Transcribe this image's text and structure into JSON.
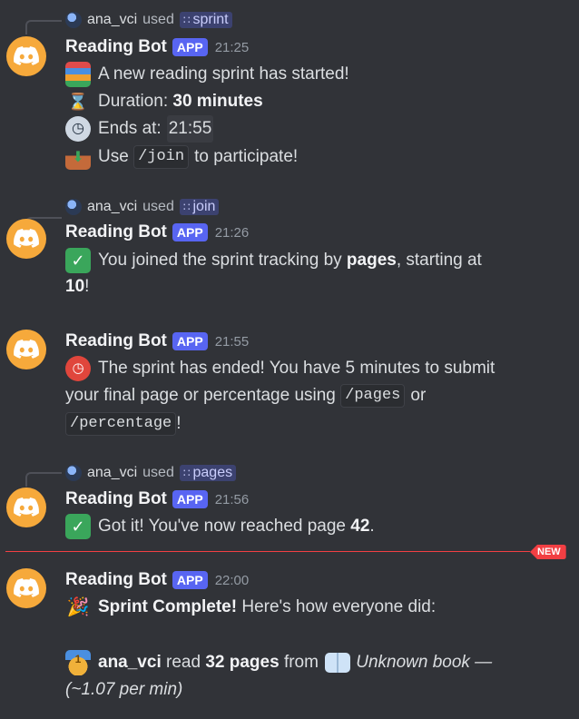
{
  "messages": [
    {
      "reply": {
        "user": "ana_vci",
        "used": "used",
        "command": "sprint"
      },
      "author": "Reading Bot",
      "badge": "APP",
      "time": "21:25",
      "lines": {
        "l1": "A new reading sprint has started!",
        "duration_label": "Duration:",
        "duration_value": "30 minutes",
        "ends_label": "Ends at:",
        "ends_value": "21:55",
        "use_label": "Use",
        "use_code": "/join",
        "use_suffix": "to participate!"
      }
    },
    {
      "reply": {
        "user": "ana_vci",
        "used": "used",
        "command": "join"
      },
      "author": "Reading Bot",
      "badge": "APP",
      "time": "21:26",
      "lines": {
        "prefix": "You joined the sprint tracking by",
        "bold": "pages",
        "suffix": ", starting at",
        "value": "10",
        "end": "!"
      }
    },
    {
      "author": "Reading Bot",
      "badge": "APP",
      "time": "21:55",
      "lines": {
        "l1": "The sprint has ended! You have 5 minutes to submit",
        "l2": "your final page or percentage using",
        "code1": "/pages",
        "or": "or",
        "code2": "/percentage",
        "end": "!"
      }
    },
    {
      "reply": {
        "user": "ana_vci",
        "used": "used",
        "command": "pages"
      },
      "author": "Reading Bot",
      "badge": "APP",
      "time": "21:56",
      "lines": {
        "prefix": "Got it! You've now reached page",
        "value": "42",
        "end": "."
      }
    },
    {
      "author": "Reading Bot",
      "badge": "APP",
      "time": "22:00",
      "lines": {
        "title": "Sprint Complete!",
        "title_suffix": "Here's how everyone did:",
        "user": "ana_vci",
        "read": "read",
        "amount": "32 pages",
        "from": "from",
        "book": "Unknown book —",
        "rate": "(~1.07 per min)"
      }
    }
  ],
  "divider": {
    "label": "NEW"
  },
  "colors": {
    "background": "#313338",
    "app_badge": "#5865f2",
    "avatar": "#f6a93b",
    "new_divider": "#f23f43"
  },
  "icons": [
    "books-icon",
    "hourglass-icon",
    "clock-icon",
    "inbox-tray-icon",
    "check-mark-icon",
    "alarm-clock-icon",
    "party-popper-icon",
    "first-place-medal-icon",
    "open-book-icon",
    "discord-logo-icon"
  ]
}
